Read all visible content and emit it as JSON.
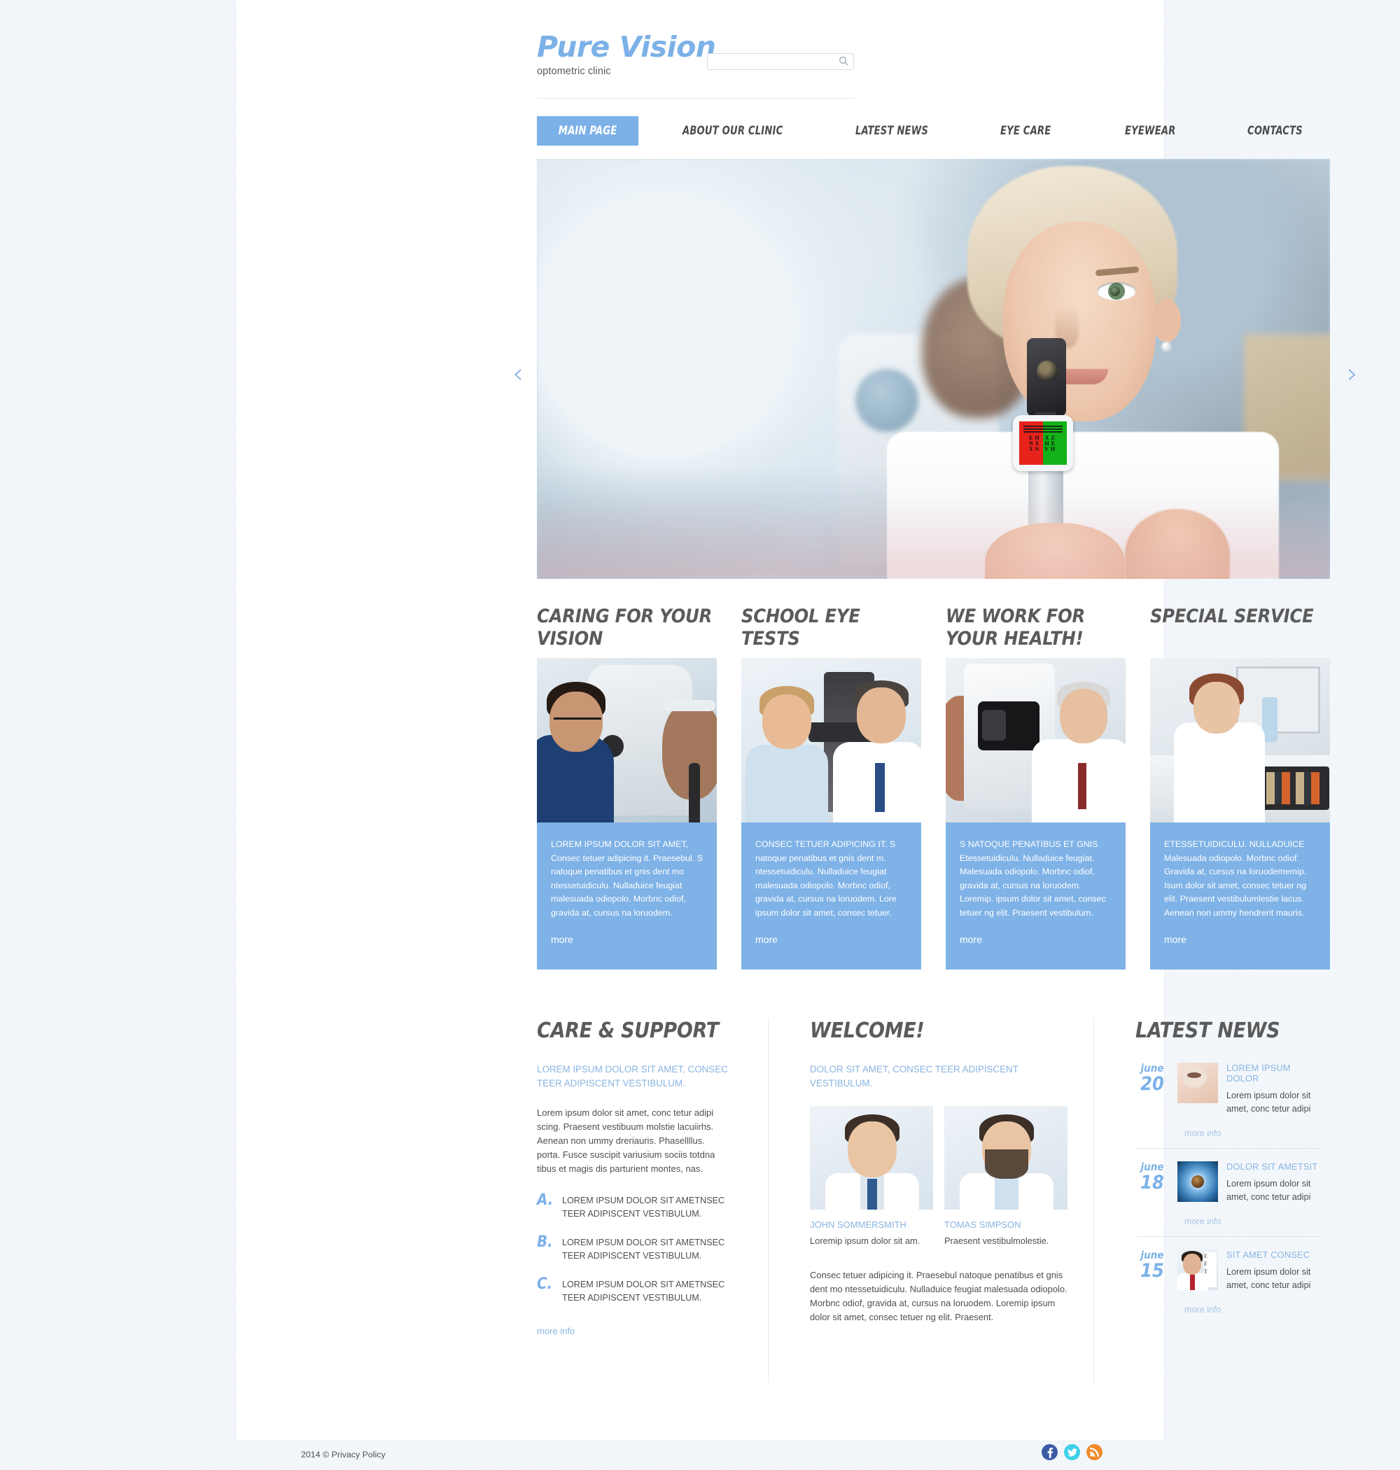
{
  "brand": {
    "name": "Pure Vision",
    "tagline": "optometric clinic"
  },
  "search": {
    "value": "",
    "placeholder": "",
    "icon": "search-icon"
  },
  "nav": {
    "items": [
      {
        "label": "MAIN PAGE",
        "active": true
      },
      {
        "label": "ABOUT OUR CLINIC",
        "active": false
      },
      {
        "label": "LATEST NEWS",
        "active": false
      },
      {
        "label": "EYE CARE",
        "active": false
      },
      {
        "label": "EYEWEAR",
        "active": false
      },
      {
        "label": "CONTACTS",
        "active": false
      }
    ]
  },
  "slider": {
    "prev_icon": "chevron-left-icon",
    "next_icon": "chevron-right-icon",
    "prev_glyph": "‹",
    "next_glyph": "›",
    "eye_chart": {
      "rows": [
        "EH XZ",
        "NX HE",
        "XN VH"
      ],
      "left_color": "#e8231c",
      "right_color": "#12b218"
    }
  },
  "cards": [
    {
      "title": "CARING FOR YOUR VISION",
      "text": "LOREM IPSUM DOLOR SIT AMET, Consec tetuer adipicing it. Praesebul. S natoque penatibus et gnis dent mo ntessetuidiculu. Nulladuice feugiat malesuada odiopolo. Morbnc odiof, gravida at, cursus na loruodem.",
      "more": "more"
    },
    {
      "title": "SCHOOL EYE TESTS",
      "text": "CONSEC TETUER ADIPICING IT. S natoque penatibus et gnis dent m. ntessetuidiculu. Nulladuice feugiat malesuada odiopolo. Morbnc odiof, gravida at, cursus na loruodem. Lore ipsum dolor sit amet, consec tetuer.",
      "more": "more"
    },
    {
      "title": "WE WORK FOR YOUR HEALTH!",
      "text": "S NATOQUE PENATIBUS ET GNIS Etessetuidiculu. Nulladuice feugiat. Malesuada odiopolo. Morbnc odiof, gravida at, cursus na loruodem. Loremip. ipsum dolor sit amet, consec tetuer ng elit. Praesent vestibulum.",
      "more": "more"
    },
    {
      "title": "SPECIAL SERVICE",
      "text": "ETESSETUIDICULU. NULLADUICE Malesuada odiopolo. Morbnc odiof. Gravida at, cursus na loruodememip. Isum dolor sit amet, consec tetuer ng elit. Praesent vestibulumlestie lacus. Aenean non ummy hendrerit mauris.",
      "more": "more"
    }
  ],
  "care": {
    "title": "CARE & SUPPORT",
    "lead": "LOREM IPSUM DOLOR SIT AMET, CONSEC TEER ADIPISCENT VESTIBULUM.",
    "paragraph": "Lorem ipsum dolor sit amet, conc tetur adipi scing. Praesent vestibuum molstie lacuiirhs. Aenean non ummy dreriauris. Phasellllus. porta. Fusce suscipit variusium sociis totdna tibus et magis dis parturient montes, nas.",
    "items": [
      {
        "mark": "A.",
        "text": "LOREM IPSUM DOLOR SIT AMETNSEC TEER ADIPISCENT VESTIBULUM."
      },
      {
        "mark": "B.",
        "text": "LOREM IPSUM DOLOR SIT AMETNSEC TEER ADIPISCENT VESTIBULUM."
      },
      {
        "mark": "C.",
        "text": "LOREM IPSUM DOLOR SIT AMETNSEC TEER ADIPISCENT VESTIBULUM."
      }
    ],
    "more": "more info"
  },
  "welcome": {
    "title": "WELCOME!",
    "lead": "DOLOR SIT AMET, CONSEC TEER ADIPISCENT VESTIBULUM.",
    "doctors": [
      {
        "name": "JOHN SOMMERSMITH",
        "desc": "Loremip ipsum dolor sit am."
      },
      {
        "name": "TOMAS SIMPSON",
        "desc": "Praesent vestibulmolestie."
      }
    ],
    "paragraph": "Consec tetuer adipicing it. Praesebul natoque penatibus et gnis dent mo ntessetuidiculu. Nulladuice feugiat  malesuada odiopolo. Morbnc odiof,  gravida at, cursus na loruodem. Loremip ipsum dolor sit amet, consec tetuer ng elit. Praesent."
  },
  "news": {
    "title": "LATEST NEWS",
    "items": [
      {
        "month": "june",
        "day": "20",
        "title": "LOREM IPSUM DOLOR",
        "text": "Lorem ipsum dolor sit amet, conc tetur adipi",
        "more": "more info",
        "thumb": "contact-lens-photo"
      },
      {
        "month": "june",
        "day": "18",
        "title": "DOLOR SIT AMETSIT",
        "text": "Lorem ipsum dolor sit amet, conc tetur adipi",
        "more": "more info",
        "thumb": "blue-eye-photo"
      },
      {
        "month": "june",
        "day": "15",
        "title": "SIT AMET CONSEC",
        "text": "Lorem ipsum dolor sit amet, conc tetur adipi",
        "more": "more info",
        "thumb": "doctor-eye-chart-photo"
      }
    ]
  },
  "footer": {
    "copyright": "2014 © Privacy Policy",
    "socials": [
      {
        "name": "facebook",
        "glyph": "f",
        "color": "#3b5ba5"
      },
      {
        "name": "twitter",
        "glyph": "🐦",
        "color": "#3fd0e8"
      },
      {
        "name": "rss",
        "glyph": "🔊",
        "color": "#f08a28"
      }
    ]
  },
  "colors": {
    "accent": "#7cb1e8",
    "card_bg": "#7fb2e6",
    "heading": "#5b5b5b",
    "body_text": "#4f4f4f",
    "link": "#89b4e0"
  }
}
